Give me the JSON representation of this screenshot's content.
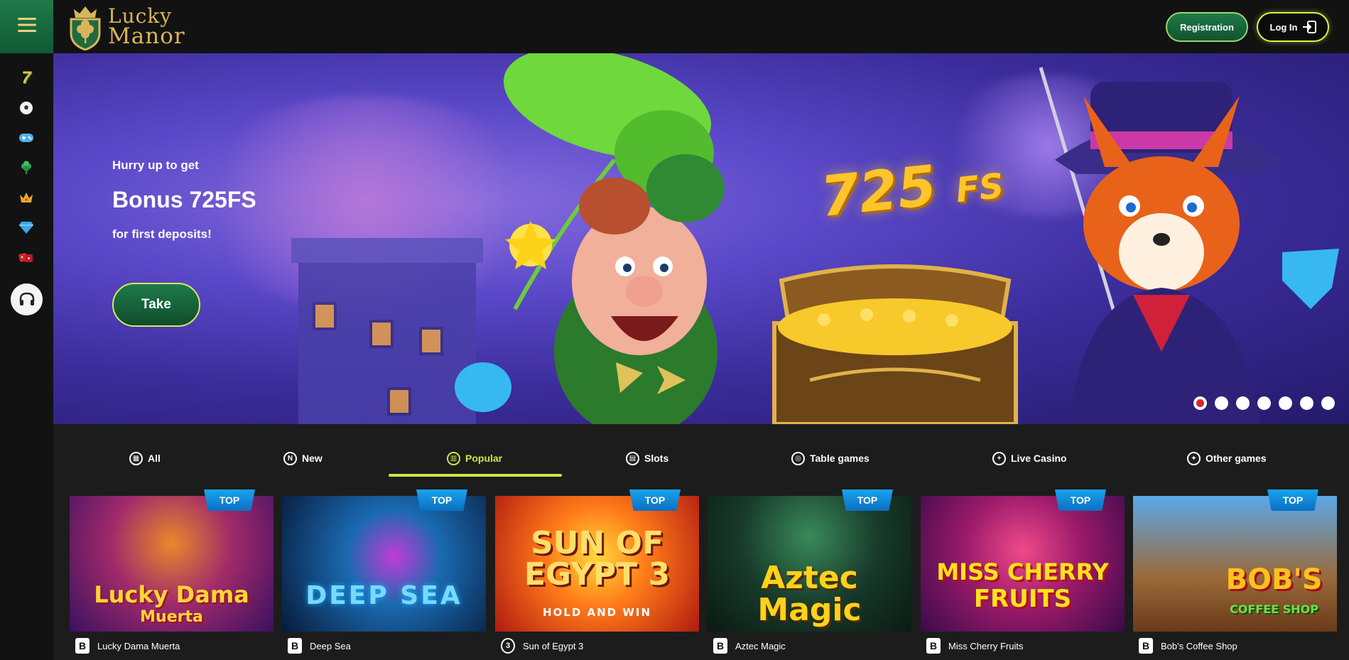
{
  "header": {
    "logo_line1": "Lucky",
    "logo_line2": "Manor",
    "registration_label": "Registration",
    "login_label": "Log In"
  },
  "sidebar": {
    "items": [
      {
        "icon": "slot-seven-icon"
      },
      {
        "icon": "soccer-ball-icon"
      },
      {
        "icon": "gamepad-icon"
      },
      {
        "icon": "clover-icon"
      },
      {
        "icon": "crown-icon"
      },
      {
        "icon": "diamond-icon"
      },
      {
        "icon": "dice-icon"
      }
    ],
    "support_icon": "headset-icon"
  },
  "banner": {
    "line1": "Hurry up to get",
    "line2": "Bonus 725FS",
    "line3": "for first deposits!",
    "cta_label": "Take",
    "art_number": "725",
    "art_suffix": "FS",
    "slides_total": 7,
    "active_slide": 1
  },
  "tabs": [
    {
      "label": "All",
      "icon": "grid-icon"
    },
    {
      "label": "New",
      "icon": "new-icon"
    },
    {
      "label": "Popular",
      "icon": "popular-icon",
      "active": true
    },
    {
      "label": "Slots",
      "icon": "slots-icon"
    },
    {
      "label": "Table games",
      "icon": "table-games-icon"
    },
    {
      "label": "Live Casino",
      "icon": "live-casino-icon"
    },
    {
      "label": "Other games",
      "icon": "other-games-icon"
    }
  ],
  "games": [
    {
      "name": "Lucky Dama Muerta",
      "badge": "TOP",
      "provider": "B",
      "art_line1": "Lucky Dama",
      "art_line2": "Muerta"
    },
    {
      "name": "Deep Sea",
      "badge": "TOP",
      "provider": "B",
      "art_line1": "DEEP SEA",
      "art_line2": ""
    },
    {
      "name": "Sun of Egypt 3",
      "badge": "TOP",
      "provider": "3",
      "art_line1": "SUN OF EGYPT 3",
      "art_line2": "HOLD AND WIN"
    },
    {
      "name": "Aztec Magic",
      "badge": "TOP",
      "provider": "B",
      "art_line1": "Aztec",
      "art_line2": "Magic"
    },
    {
      "name": "Miss Cherry Fruits",
      "badge": "TOP",
      "provider": "B",
      "art_line1": "MISS CHERRY",
      "art_line2": "FRUITS"
    },
    {
      "name": "Bob's Coffee Shop",
      "badge": "TOP",
      "provider": "B",
      "art_line1": "BOB'S",
      "art_line2": "COFFEE SHOP"
    }
  ],
  "colors": {
    "accent_green": "#1f7a4a",
    "accent_lime": "#c9e84a",
    "badge_blue": "#1a8fe0",
    "gold": "#d9b45a"
  }
}
